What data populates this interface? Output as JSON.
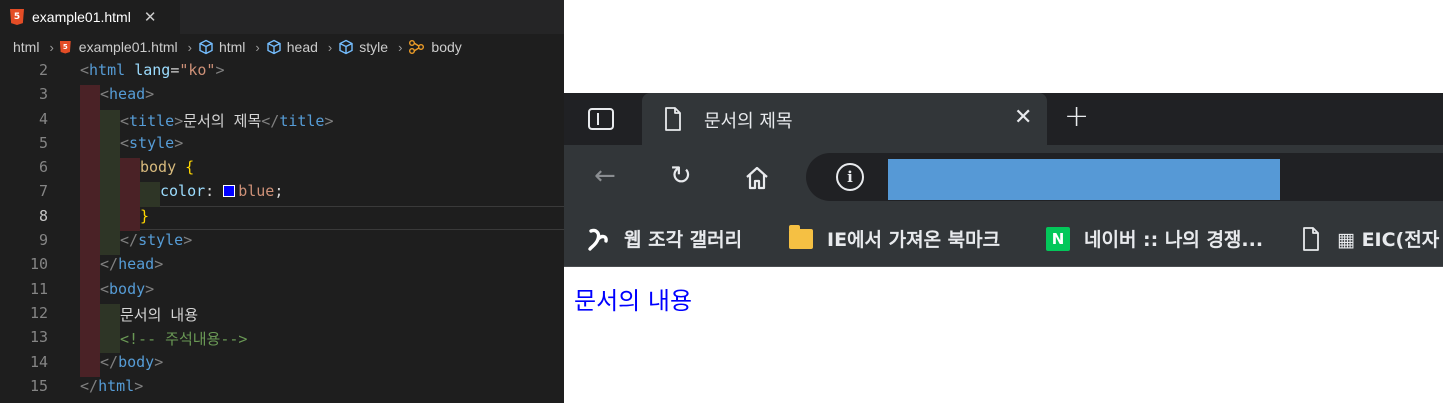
{
  "editor": {
    "tab": {
      "label": "example01.html",
      "icon": "html5-icon",
      "close": "✕"
    },
    "breadcrumb": [
      "html",
      "example01.html",
      "html",
      "head",
      "style",
      "body"
    ],
    "current_line": 8,
    "lines": [
      {
        "num": "2",
        "tokens": [
          [
            "c-punc",
            "<"
          ],
          [
            "c-tag",
            "html"
          ],
          [
            "c-text",
            " "
          ],
          [
            "c-attr",
            "lang"
          ],
          [
            "c-text",
            "="
          ],
          [
            "c-str",
            "\"ko\""
          ],
          [
            "c-punc",
            ">"
          ]
        ]
      },
      {
        "num": "3",
        "tokens": [
          [
            "c-punc",
            "<"
          ],
          [
            "c-tag",
            "head"
          ],
          [
            "c-punc",
            ">"
          ]
        ]
      },
      {
        "num": "4",
        "tokens": [
          [
            "c-punc",
            "<"
          ],
          [
            "c-tag",
            "title"
          ],
          [
            "c-punc",
            ">"
          ],
          [
            "c-text",
            "문서의 제목"
          ],
          [
            "c-punc",
            "</"
          ],
          [
            "c-tag",
            "title"
          ],
          [
            "c-punc",
            ">"
          ]
        ]
      },
      {
        "num": "5",
        "tokens": [
          [
            "c-punc",
            "<"
          ],
          [
            "c-tag",
            "style"
          ],
          [
            "c-punc",
            ">"
          ]
        ]
      },
      {
        "num": "6",
        "tokens": [
          [
            "c-sel",
            "body "
          ],
          [
            "c-brace",
            "{"
          ]
        ]
      },
      {
        "num": "7",
        "tokens": [
          [
            "c-prop",
            "color"
          ],
          [
            "c-text",
            ": "
          ],
          [
            "swatch",
            ""
          ],
          [
            "c-val",
            "blue"
          ],
          [
            "c-text",
            ";"
          ]
        ]
      },
      {
        "num": "8",
        "tokens": [
          [
            "c-brace",
            "}"
          ]
        ]
      },
      {
        "num": "9",
        "tokens": [
          [
            "c-punc",
            "</"
          ],
          [
            "c-tag",
            "style"
          ],
          [
            "c-punc",
            ">"
          ]
        ]
      },
      {
        "num": "10",
        "tokens": [
          [
            "c-punc",
            "</"
          ],
          [
            "c-tag",
            "head"
          ],
          [
            "c-punc",
            ">"
          ]
        ]
      },
      {
        "num": "11",
        "tokens": [
          [
            "c-punc",
            "<"
          ],
          [
            "c-tag",
            "body"
          ],
          [
            "c-punc",
            ">"
          ]
        ]
      },
      {
        "num": "12",
        "tokens": [
          [
            "c-text",
            "문서의 내용"
          ]
        ]
      },
      {
        "num": "13",
        "tokens": [
          [
            "c-cmt",
            "<!-- 주석내용-->"
          ]
        ]
      },
      {
        "num": "14",
        "tokens": [
          [
            "c-punc",
            "</"
          ],
          [
            "c-tag",
            "body"
          ],
          [
            "c-punc",
            ">"
          ]
        ]
      },
      {
        "num": "15",
        "tokens": [
          [
            "c-punc",
            "</"
          ],
          [
            "c-tag",
            "html"
          ],
          [
            "c-punc",
            ">"
          ]
        ]
      }
    ]
  },
  "browser": {
    "tab_title": "문서의 제목",
    "tab_close": "✕",
    "new_tab": "+",
    "back": "←",
    "reload": "↻",
    "home": "⌂",
    "info": "i",
    "bookmarks": [
      {
        "label": "웹 조각 갤러리",
        "icon": "web-slice-icon"
      },
      {
        "label": "IE에서 가져온 북마크",
        "icon": "folder-icon"
      },
      {
        "label": "네이버 :: 나의 경쟁...",
        "icon": "naver-icon"
      },
      {
        "label": "▦ EIC(전자",
        "icon": "document-icon"
      }
    ],
    "page_text": "문서의 내용",
    "colors": {
      "page_text": "#0000ff",
      "url_highlight": "#5699d6"
    }
  }
}
